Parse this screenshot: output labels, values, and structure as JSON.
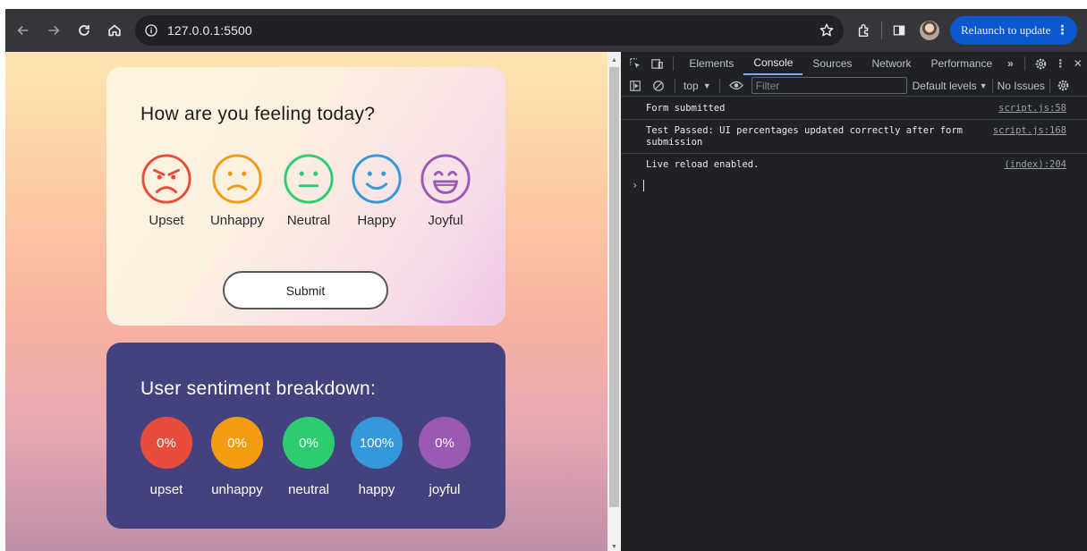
{
  "browser": {
    "url": "127.0.0.1:5500",
    "relaunch_label": "Relaunch to update",
    "toolbar_icons": [
      "back-arrow-icon",
      "forward-arrow-icon",
      "reload-icon",
      "home-icon",
      "site-info-icon",
      "star-icon",
      "extensions-icon",
      "side-panel-icon",
      "profile-avatar",
      "kebab-menu-icon"
    ]
  },
  "feedback": {
    "question": "How are you feeling today?",
    "options": [
      {
        "label": "Upset",
        "color": "#e74c3c",
        "icon": "angry-face-icon"
      },
      {
        "label": "Unhappy",
        "color": "#f39c12",
        "icon": "sad-face-icon"
      },
      {
        "label": "Neutral",
        "color": "#2ecc71",
        "icon": "neutral-face-icon"
      },
      {
        "label": "Happy",
        "color": "#3498db",
        "icon": "smile-face-icon"
      },
      {
        "label": "Joyful",
        "color": "#9b59b6",
        "icon": "grin-face-icon"
      }
    ],
    "submit_label": "Submit"
  },
  "summary": {
    "title": "User sentiment breakdown:",
    "stats": [
      {
        "name": "upset",
        "value": "0%",
        "color": "#e74c3c"
      },
      {
        "name": "unhappy",
        "value": "0%",
        "color": "#f39c12"
      },
      {
        "name": "neutral",
        "value": "0%",
        "color": "#2ecc71"
      },
      {
        "name": "happy",
        "value": "100%",
        "color": "#3498db"
      },
      {
        "name": "joyful",
        "value": "0%",
        "color": "#9b59b6"
      }
    ]
  },
  "devtools": {
    "tabs": [
      "Elements",
      "Console",
      "Sources",
      "Network",
      "Performance"
    ],
    "active_tab": "Console",
    "context": "top",
    "filter_placeholder": "Filter",
    "levels_label": "Default levels",
    "issues_label": "No Issues",
    "messages": [
      {
        "text": "Form submitted",
        "source": "script.js:58"
      },
      {
        "text": "Test Passed: UI percentages updated correctly after form submission",
        "source": "script.js:168"
      },
      {
        "text": "Live reload enabled.",
        "source": "(index):204"
      }
    ],
    "prompt_symbol": "›"
  }
}
